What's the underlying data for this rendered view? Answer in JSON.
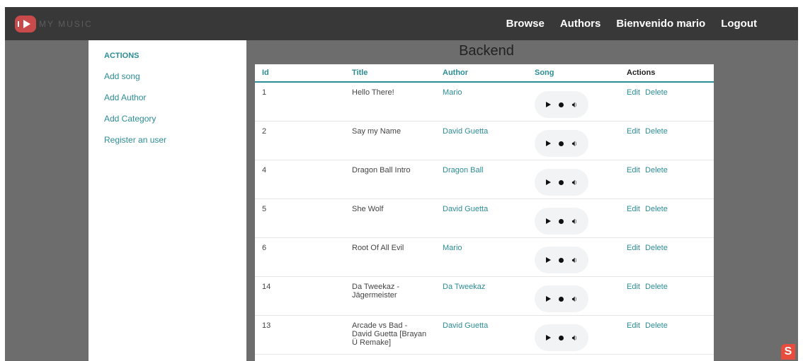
{
  "header": {
    "logo_text": "MY MUSIC",
    "nav": [
      "Browse",
      "Authors",
      "Bienvenido mario",
      "Logout"
    ]
  },
  "sidebar": {
    "heading": "ACTIONS",
    "items": [
      "Add song",
      "Add Author",
      "Add Category",
      "Register an user"
    ]
  },
  "main": {
    "title": "Backend",
    "columns": [
      "Id",
      "Title",
      "Author",
      "Song",
      "Actions"
    ],
    "rows": [
      {
        "id": "1",
        "title": "Hello There!",
        "author": "Mario"
      },
      {
        "id": "2",
        "title": "Say my Name",
        "author": "David Guetta"
      },
      {
        "id": "4",
        "title": "Dragon Ball Intro",
        "author": "Dragon Ball"
      },
      {
        "id": "5",
        "title": "She Wolf",
        "author": "David Guetta"
      },
      {
        "id": "6",
        "title": "Root Of All Evil",
        "author": "Mario"
      },
      {
        "id": "14",
        "title": "Da Tweekaz - Jägermeister",
        "author": "Da Tweekaz"
      },
      {
        "id": "13",
        "title": "Arcade vs Bad - David Guetta [Brayan Ü Remake]",
        "author": "David Guetta"
      }
    ],
    "edit_label": "Edit",
    "delete_label": "Delete"
  },
  "colors": {
    "accent": "#2c8d95",
    "topbar": "#383838",
    "background": "#6d6d6d",
    "logo": "#c94a4a"
  },
  "icons": [
    "logo-icon",
    "play-icon",
    "record-dot-icon",
    "volume-icon",
    "corner-badge-icon"
  ]
}
